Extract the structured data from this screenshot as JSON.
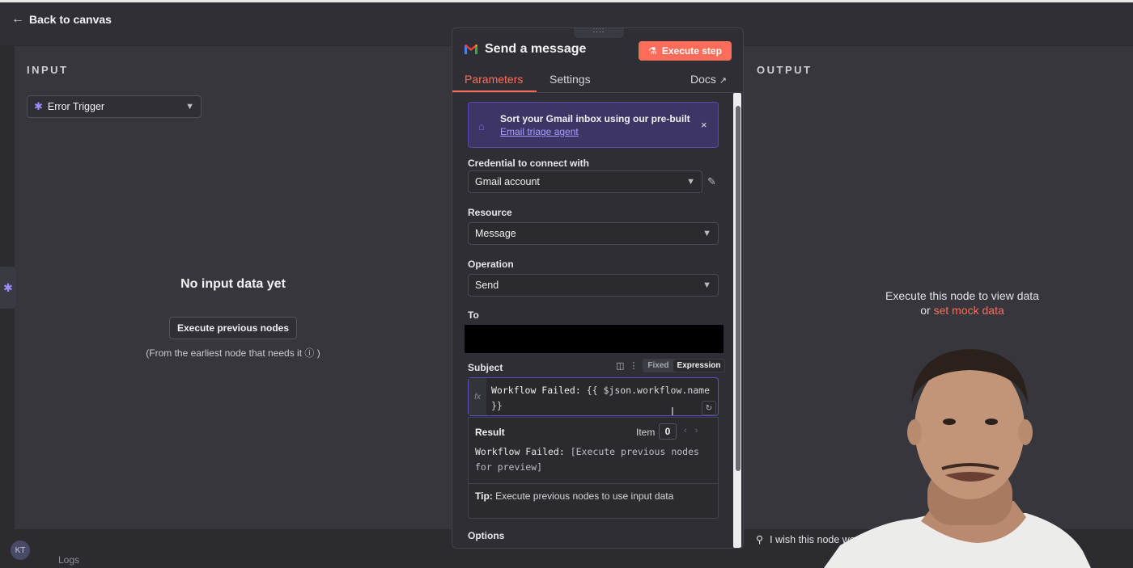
{
  "topbar": {
    "back_label": "Back to canvas"
  },
  "input_panel": {
    "title": "INPUT",
    "trigger_select": "Error Trigger",
    "empty_title": "No input data yet",
    "exec_prev_button": "Execute previous nodes",
    "earliest_note": "(From the earliest node that needs it",
    "earliest_close": ")"
  },
  "output_panel": {
    "title": "OUTPUT",
    "msg_line1": "Execute this node to view data",
    "msg_or": "or",
    "mock_link": "set mock data"
  },
  "modal": {
    "drag_handle": "::::",
    "title": "Send a message",
    "execute_step": "Execute step",
    "tabs": [
      {
        "label": "Parameters",
        "active": true
      },
      {
        "label": "Settings",
        "active": false
      }
    ],
    "docs_label": "Docs",
    "banner": {
      "text": "Sort your Gmail inbox using our pre-built",
      "link": "Email triage agent",
      "close": "×"
    },
    "credential": {
      "label": "Credential to connect with",
      "value": "Gmail account"
    },
    "resource": {
      "label": "Resource",
      "value": "Message"
    },
    "operation": {
      "label": "Operation",
      "value": "Send"
    },
    "to": {
      "label": "To"
    },
    "subject": {
      "label": "Subject",
      "mode_fixed": "Fixed",
      "mode_expression": "Expression",
      "fx": "fx",
      "code_prefix": "Workflow Failed: ",
      "code_template_1": "{{ $json.workflow.name",
      "code_template_2": "}}"
    },
    "result": {
      "label": "Result",
      "item_label": "Item",
      "item_value": "0",
      "line1_prefix": "Workflow Failed: ",
      "line1_preview": "[Execute previous nodes",
      "line2_preview": "for preview]",
      "tip_bold": "Tip:",
      "tip_text": " Execute previous nodes to use input data"
    },
    "options_label": "Options"
  },
  "bottom": {
    "avatar_initials": "KT",
    "logs_label": "Logs",
    "wish_text": "I wish this node would"
  },
  "colors": {
    "accent": "#ff6d5a",
    "banner_bg": "#3d3566",
    "expression_border": "#5d50c7",
    "background": "#2b2b30"
  }
}
